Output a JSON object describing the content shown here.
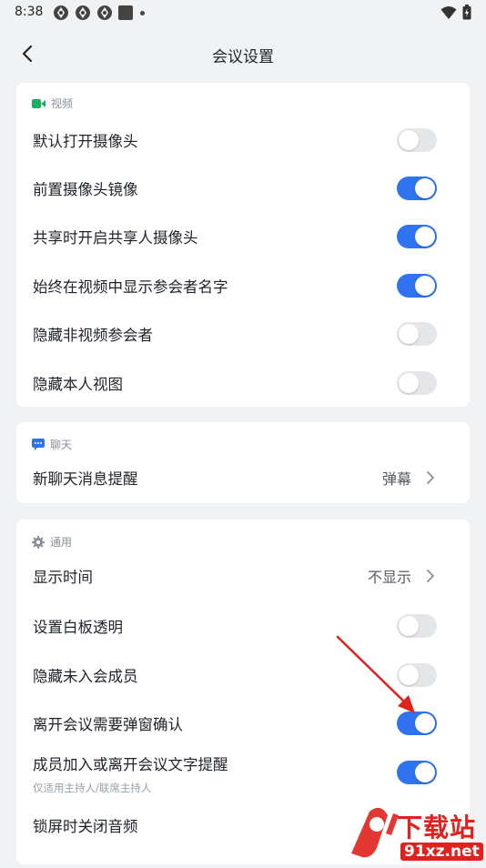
{
  "status_bar": {
    "time": "8:38",
    "icons": [
      "app-icon",
      "app-icon",
      "app-icon",
      "square-icon",
      "dot-icon"
    ],
    "right_icons": [
      "wifi-icon",
      "battery-icon"
    ]
  },
  "header": {
    "back_icon": "chevron-left-icon",
    "title": "会议设置"
  },
  "sections": {
    "video": {
      "title": "视频",
      "icon": "video-camera-icon",
      "icon_color": "#1aad63",
      "items": [
        {
          "label": "默认打开摄像头",
          "on": false
        },
        {
          "label": "前置摄像头镜像",
          "on": true
        },
        {
          "label": "共享时开启共享人摄像头",
          "on": true
        },
        {
          "label": "始终在视频中显示参会者名字",
          "on": true
        },
        {
          "label": "隐藏非视频参会者",
          "on": false
        },
        {
          "label": "隐藏本人视图",
          "on": false
        }
      ]
    },
    "chat": {
      "title": "聊天",
      "icon": "chat-bubble-icon",
      "icon_color": "#2f73f1",
      "items": [
        {
          "label": "新聊天消息提醒",
          "value": "弹幕"
        }
      ]
    },
    "general": {
      "title": "通用",
      "icon": "gear-icon",
      "icon_color": "#8a8f99",
      "items": [
        {
          "label": "显示时间",
          "value": "不显示"
        },
        {
          "label": "设置白板透明",
          "on": false
        },
        {
          "label": "隐藏未入会成员",
          "on": false
        },
        {
          "label": "离开会议需要弹窗确认",
          "on": true
        },
        {
          "label": "成员加入或离开会议文字提醒",
          "sub": "仅适用主持人/联席主持人",
          "on": true
        },
        {
          "label": "锁屏时关闭音频"
        }
      ]
    }
  },
  "colors": {
    "toggle_on": "#2f73f1",
    "toggle_off": "#e4e6ea",
    "annotation_arrow": "#e0211d",
    "watermark": "#e0211d"
  },
  "watermark": {
    "text": "下载站",
    "domain": "91xz.net"
  }
}
